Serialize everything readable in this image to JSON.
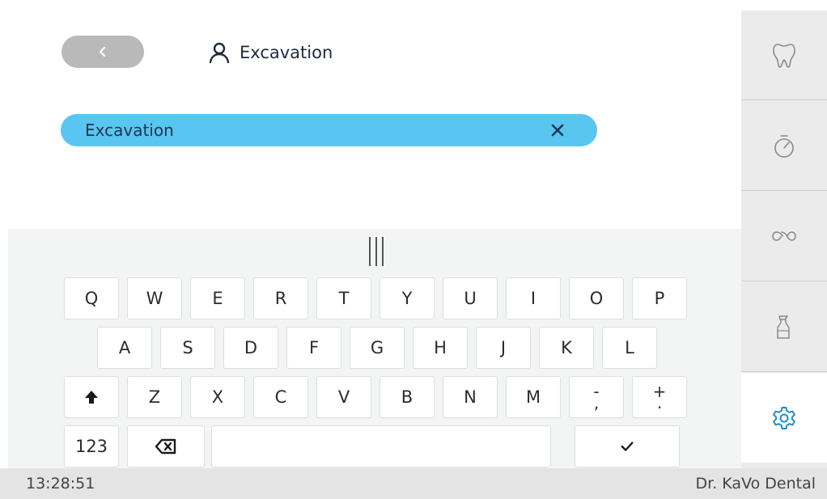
{
  "header": {
    "back_icon": "chevron-left-icon",
    "title": "Excavation",
    "title_icon": "user-icon"
  },
  "search": {
    "value": "Excavation",
    "clear_icon": "close-icon",
    "accent_color": "#58c6f0"
  },
  "keyboard": {
    "handle_icon": "drag-handle-icon",
    "row1": [
      "Q",
      "W",
      "E",
      "R",
      "T",
      "Y",
      "U",
      "I",
      "O",
      "P"
    ],
    "row2": [
      "A",
      "S",
      "D",
      "F",
      "G",
      "H",
      "J",
      "K",
      "L"
    ],
    "row3": [
      "Z",
      "X",
      "C",
      "V",
      "B",
      "N",
      "M"
    ],
    "row3_punct": [
      {
        "top": "-",
        "bottom": ","
      },
      {
        "top": "+",
        "bottom": "."
      }
    ],
    "shift_icon": "shift-arrow-icon",
    "numbers_label": "123",
    "backspace_icon": "backspace-icon",
    "enter_icon": "check-icon"
  },
  "sidebar": {
    "items": [
      {
        "icon": "tooth-icon",
        "active": false
      },
      {
        "icon": "stopwatch-icon",
        "active": false
      },
      {
        "icon": "infinity-icon",
        "active": false
      },
      {
        "icon": "spray-bottle-icon",
        "active": false
      },
      {
        "icon": "gear-icon",
        "active": true
      }
    ],
    "active_color": "#1f8fd0"
  },
  "status": {
    "time": "13:28:51",
    "user": "Dr. KaVo Dental"
  }
}
